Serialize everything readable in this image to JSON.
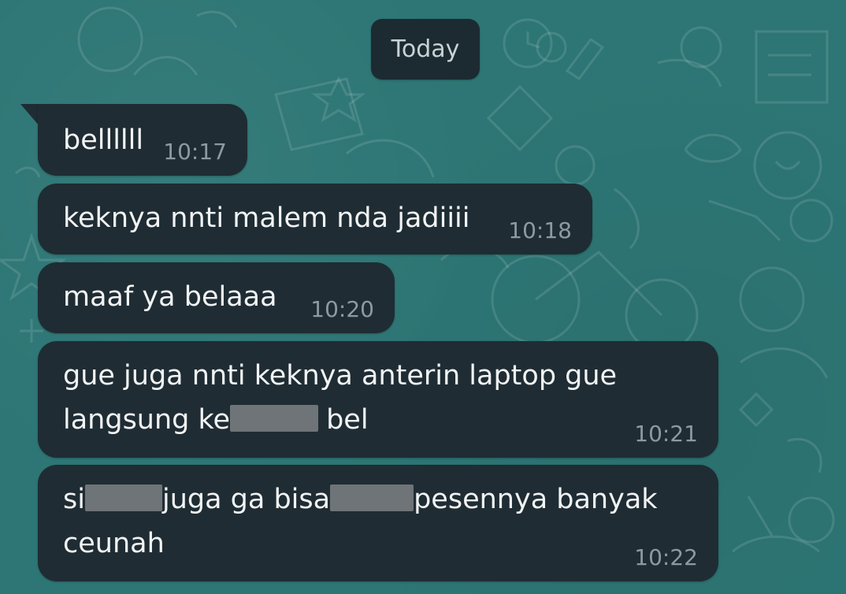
{
  "date_chip": "Today",
  "messages": [
    {
      "lines": [
        "bellllll"
      ],
      "time": "10:17"
    },
    {
      "lines": [
        "keknya nnti malem nda jadiiii"
      ],
      "time": "10:18"
    },
    {
      "lines": [
        "maaf ya belaaa"
      ],
      "time": "10:20"
    },
    {
      "line1": "gue juga nnti keknya anterin laptop gue",
      "line2_a": "langsung ke",
      "line2_b": "bel",
      "time": "10:21"
    },
    {
      "line1_a": "si",
      "line1_b": "juga ga bisa",
      "line1_c": "pesennya banyak",
      "line2": "ceunah",
      "time": "10:22"
    }
  ],
  "colors": {
    "wallpaper": "#2d7675",
    "bubble": "#1f2c33",
    "text": "#f1f3f4",
    "timestamp": "#8e9a9f",
    "date_chip_text": "#c9d2d5",
    "redaction": "#6f7478"
  }
}
